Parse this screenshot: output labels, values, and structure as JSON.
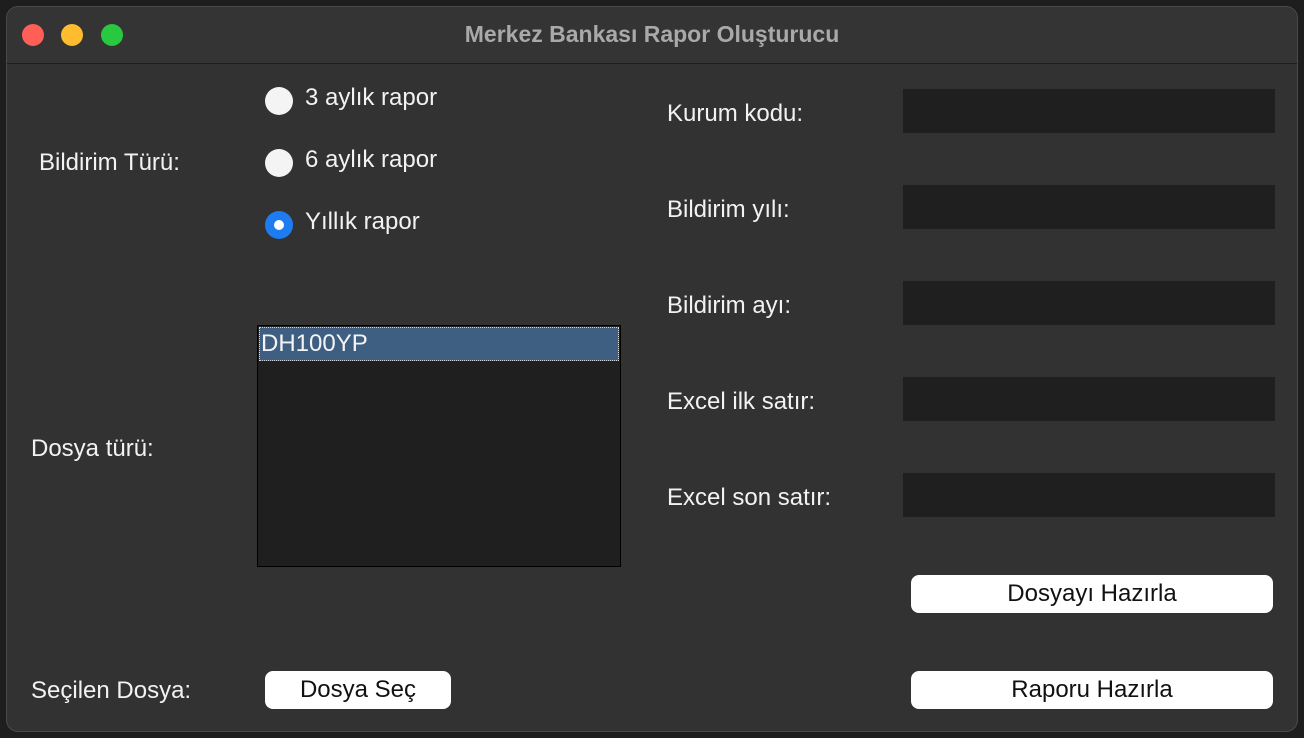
{
  "window": {
    "title": "Merkez Bankası Rapor Oluşturucu",
    "controls": [
      "close",
      "minimize",
      "maximize"
    ]
  },
  "report_type": {
    "label": "Bildirim Türü:",
    "options": [
      {
        "label": "3 aylık rapor",
        "checked": false
      },
      {
        "label": "6 aylık rapor",
        "checked": false
      },
      {
        "label": "Yıllık rapor",
        "checked": true
      }
    ]
  },
  "file_type": {
    "label": "Dosya türü:",
    "items": [
      "DH100YP"
    ],
    "selected": "DH100YP"
  },
  "fields": {
    "institution_code": {
      "label": "Kurum kodu:",
      "value": ""
    },
    "report_year": {
      "label": "Bildirim yılı:",
      "value": ""
    },
    "report_month": {
      "label": "Bildirim ayı:",
      "value": ""
    },
    "excel_first_row": {
      "label": "Excel ilk satır:",
      "value": ""
    },
    "excel_last_row": {
      "label": "Excel son satır:",
      "value": ""
    }
  },
  "buttons": {
    "prepare_file": "Dosyayı Hazırla",
    "choose_file": "Dosya Seç",
    "prepare_report": "Raporu Hazırla"
  },
  "selected_file": {
    "label": "Seçilen Dosya:"
  }
}
